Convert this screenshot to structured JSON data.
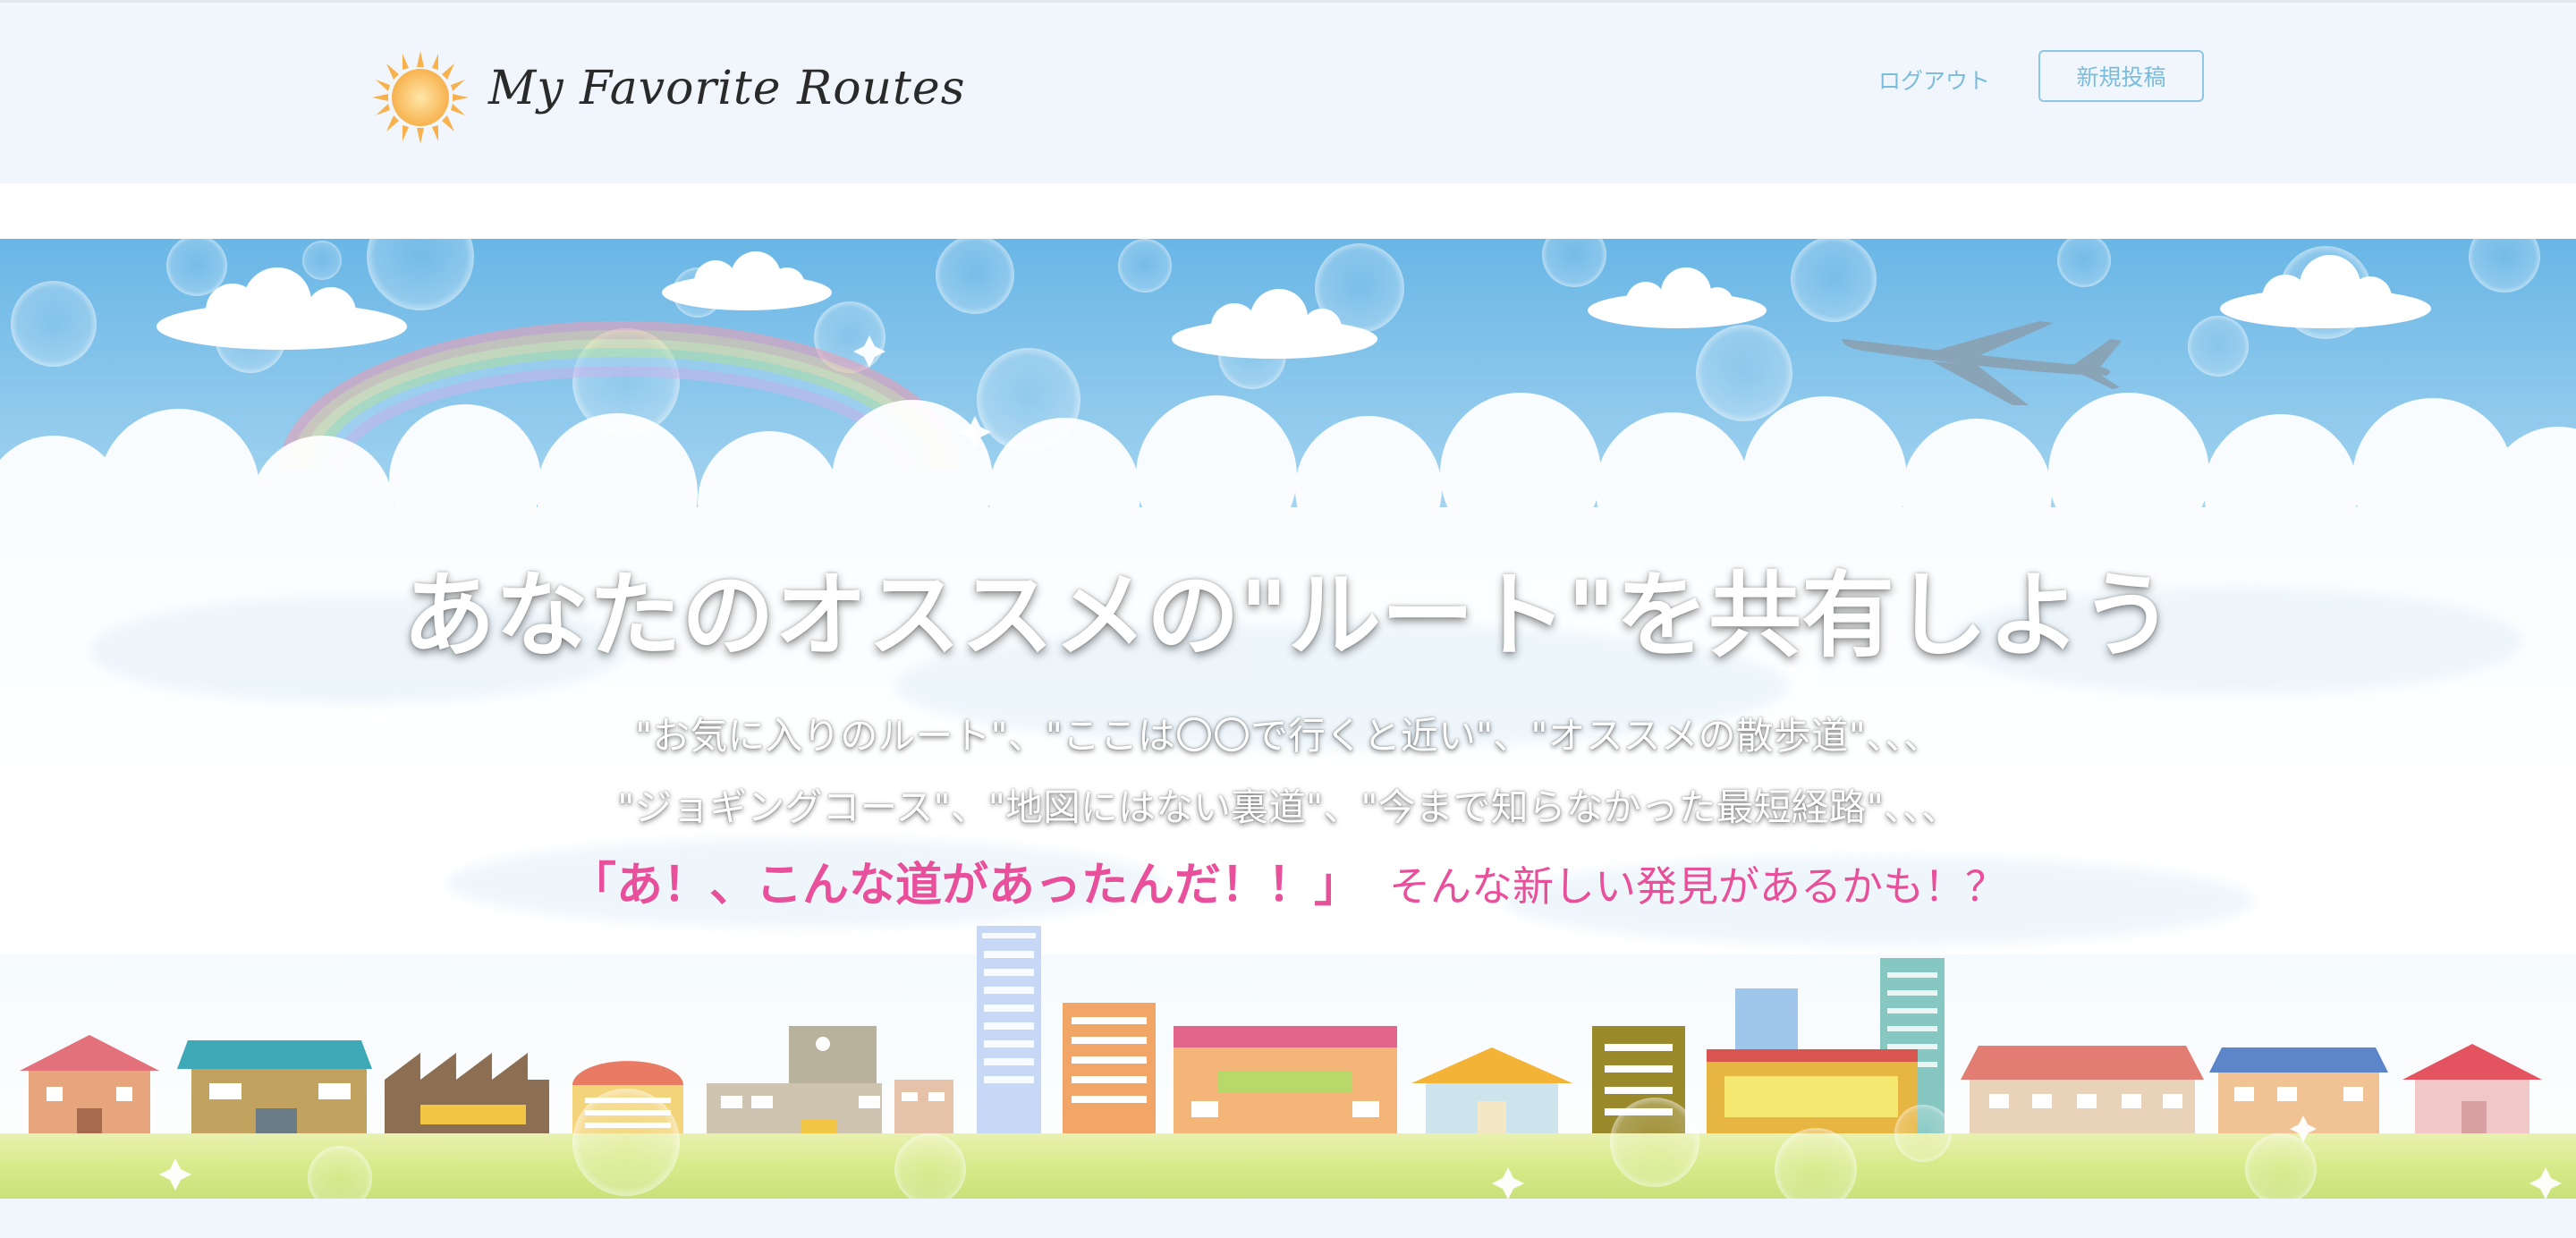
{
  "header": {
    "brand": "My Favorite Routes",
    "logo_icon": "sun-icon",
    "nav": {
      "logout_label": "ログアウト",
      "new_post_label": "新規投稿"
    }
  },
  "hero": {
    "title": "あなたのオススメの\"ルート\"を共有しよう",
    "line1": "\"お気に入りのルート\"、\"ここは〇〇で行くと近い\"、\"オススメの散歩道\"、、、",
    "line2": "\"ジョギングコース\"、\"地図にはない裏道\"、\"今まで知らなかった最短経路\"、、、",
    "highlight_a": "「あ！、こんな道があったんだ！！」",
    "highlight_b": "そんな新しい発見があるかも！？"
  },
  "colors": {
    "header_bg": "#f0f6fc",
    "accent": "#7bbcdd",
    "pink": "#e8509c",
    "sky": "#7cc4ec"
  }
}
